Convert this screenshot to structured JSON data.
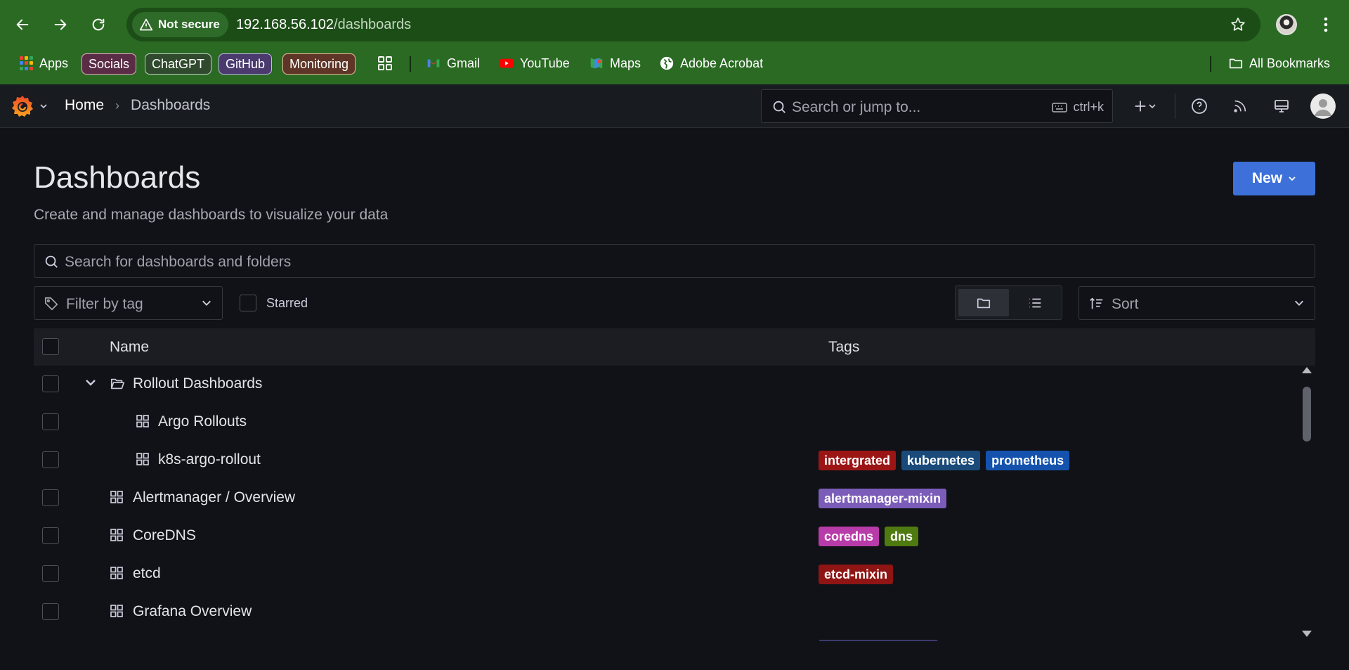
{
  "browser": {
    "security_label": "Not secure",
    "url_host": "192.168.56.102",
    "url_path": "/dashboards",
    "bookmarks": [
      {
        "label": "Apps",
        "icon": "apps-grid-icon"
      },
      {
        "label": "Socials",
        "chip_color": "#f4a6c8",
        "chip_fill": "#5a2c46"
      },
      {
        "label": "ChatGPT",
        "chip_color": "#c9d4c8",
        "chip_fill": "#2f4a2c"
      },
      {
        "label": "GitHub",
        "chip_color": "#c7b4f5",
        "chip_fill": "#4a3a6e"
      },
      {
        "label": "Monitoring",
        "chip_color": "#f7b7a0",
        "chip_fill": "#5e3526"
      },
      {
        "label": "Gmail",
        "icon": "gmail-icon"
      },
      {
        "label": "YouTube",
        "icon": "youtube-icon"
      },
      {
        "label": "Maps",
        "icon": "maps-icon"
      },
      {
        "label": "Adobe Acrobat",
        "icon": "globe-icon"
      }
    ],
    "all_bookmarks_label": "All Bookmarks"
  },
  "grafana_nav": {
    "breadcrumb_home": "Home",
    "breadcrumb_separator": "›",
    "breadcrumb_current": "Dashboards",
    "search_placeholder": "Search or jump to...",
    "search_shortcut": "ctrl+k"
  },
  "page": {
    "title": "Dashboards",
    "subtitle": "Create and manage dashboards to visualize your data",
    "new_button_label": "New",
    "search_placeholder": "Search for dashboards and folders",
    "tag_filter_placeholder": "Filter by tag",
    "starred_label": "Starred",
    "sort_placeholder": "Sort",
    "view_mode": "folder"
  },
  "table": {
    "headers": {
      "name": "Name",
      "tags": "Tags"
    },
    "rows": [
      {
        "name": "Rollout Dashboards",
        "type": "folder",
        "expanded": true,
        "depth": 0,
        "tags": []
      },
      {
        "name": "Argo Rollouts",
        "type": "dashboard",
        "depth": 1,
        "tags": []
      },
      {
        "name": "k8s-argo-rollout",
        "type": "dashboard",
        "depth": 1,
        "tags": [
          {
            "label": "intergrated",
            "color": "#9b1515"
          },
          {
            "label": "kubernetes",
            "color": "#1a4a7a"
          },
          {
            "label": "prometheus",
            "color": "#1452ad"
          }
        ]
      },
      {
        "name": "Alertmanager / Overview",
        "type": "dashboard",
        "depth": 0,
        "tags": [
          {
            "label": "alertmanager-mixin",
            "color": "#7b5cb8"
          }
        ]
      },
      {
        "name": "CoreDNS",
        "type": "dashboard",
        "depth": 0,
        "tags": [
          {
            "label": "coredns",
            "color": "#b73ba8"
          },
          {
            "label": "dns",
            "color": "#4f7a10"
          }
        ]
      },
      {
        "name": "etcd",
        "type": "dashboard",
        "depth": 0,
        "tags": [
          {
            "label": "etcd-mixin",
            "color": "#8f1414"
          }
        ]
      },
      {
        "name": "Grafana Overview",
        "type": "dashboard",
        "depth": 0,
        "tags": []
      }
    ]
  },
  "colors": {
    "browser_chrome": "#2a6a23",
    "grafana_bg": "#111217",
    "primary_button": "#3d71d9"
  }
}
